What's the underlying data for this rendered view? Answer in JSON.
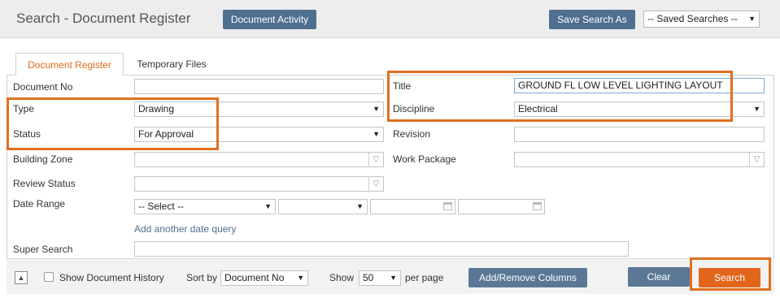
{
  "header": {
    "title": "Search - Document Register",
    "document_activity_label": "Document Activity",
    "save_search_label": "Save Search As",
    "saved_searches_value": "-- Saved Searches --"
  },
  "tabs": [
    {
      "label": "Document Register",
      "active": true
    },
    {
      "label": "Temporary Files",
      "active": false
    }
  ],
  "form": {
    "document_no": {
      "label": "Document No",
      "value": ""
    },
    "type": {
      "label": "Type",
      "value": "Drawing"
    },
    "status": {
      "label": "Status",
      "value": "For Approval"
    },
    "building_zone": {
      "label": "Building Zone",
      "value": ""
    },
    "review_status": {
      "label": "Review Status",
      "value": ""
    },
    "date_range": {
      "label": "Date Range",
      "select_value": "-- Select --",
      "second_value": "",
      "from": "",
      "to": ""
    },
    "add_date_query": "Add another date query",
    "super_search": {
      "label": "Super Search",
      "value": ""
    },
    "title": {
      "label": "Title",
      "value": "GROUND FL LOW LEVEL LIGHTING LAYOUT"
    },
    "discipline": {
      "label": "Discipline",
      "value": "Electrical"
    },
    "revision": {
      "label": "Revision",
      "value": ""
    },
    "work_package": {
      "label": "Work Package",
      "value": ""
    }
  },
  "footer": {
    "show_history_label": "Show Document History",
    "sort_by_label": "Sort by",
    "sort_by_value": "Document No",
    "show_label": "Show",
    "show_value": "50",
    "per_page_label": "per page",
    "add_remove_columns_label": "Add/Remove Columns",
    "clear_label": "Clear",
    "search_label": "Search"
  },
  "icons": {
    "dropdown": "chevron-down-icon",
    "filter": "filter-icon",
    "calendar": "calendar-icon",
    "collapse": "collapse-up-icon"
  },
  "colors": {
    "accent": "#e2651c",
    "button_blue": "#4f6f8f",
    "highlight": "#e07020"
  }
}
